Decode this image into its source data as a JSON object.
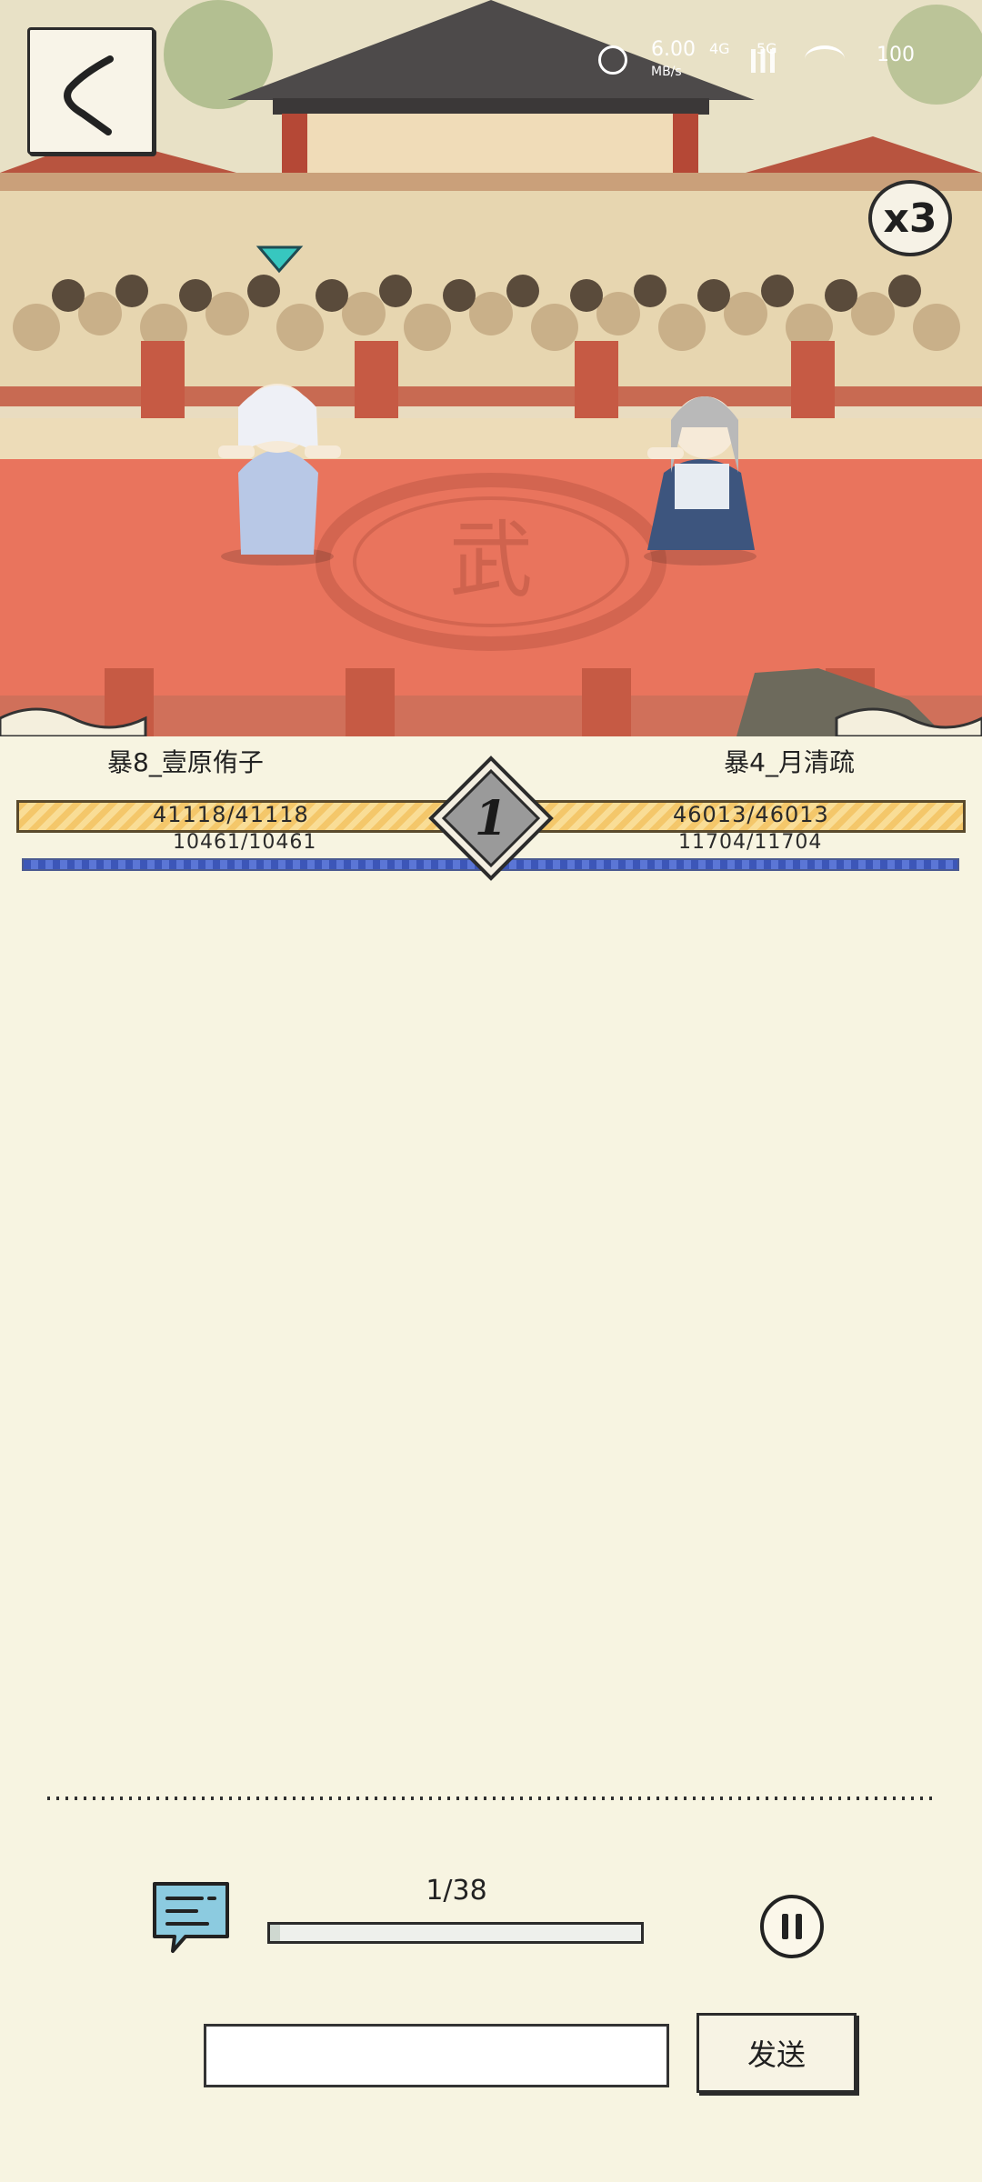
{
  "status_bar": {
    "net_speed_value": "6.00",
    "net_speed_unit": "MB/s",
    "net_4g": "4G",
    "net_5g": "5G",
    "battery": "100"
  },
  "speed_multiplier": "x3",
  "player_left": {
    "name": "暴8_壹原侑子",
    "hp_text": "41118/41118",
    "hp_fraction": 1.0,
    "mp_text": "10461/10461",
    "mp_fraction": 1.0
  },
  "player_right": {
    "name": "暴4_月清疏",
    "hp_text": "46013/46013",
    "hp_fraction": 1.0,
    "mp_text": "11704/11704",
    "mp_fraction": 1.0
  },
  "round_number": "1",
  "arena_emblem": "武",
  "progress": {
    "text": "1/38",
    "fraction": 0.026
  },
  "chat": {
    "input_value": "",
    "send_label": "发送"
  },
  "icons": [
    "back-chevron-icon",
    "speed-x3-icon",
    "chat-icon",
    "pause-icon",
    "alarm-icon",
    "wifi-icon",
    "signal-icon"
  ],
  "colors": {
    "hp_bar": "#f4c76a",
    "mp_bar": "#3c56b8",
    "arena_floor": "#e9745d",
    "panel_bg": "#f7f4e1",
    "marker": "#37c7bf"
  }
}
